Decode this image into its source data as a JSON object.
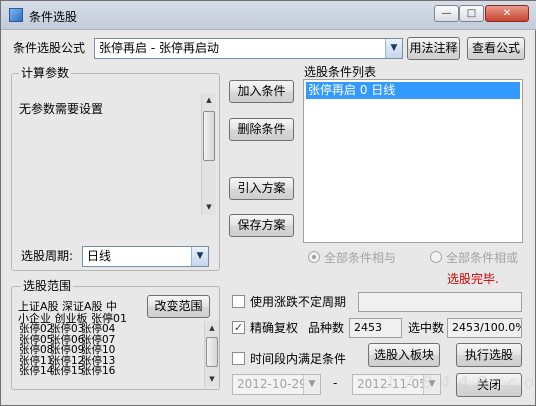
{
  "window": {
    "title": "条件选股",
    "minimize": "—",
    "maximize": "□",
    "close": "✕"
  },
  "formula": {
    "label": "条件选股公式",
    "selected": "张停再启 - 张停再启动",
    "usage_button": "用法注释",
    "view_button": "查看公式"
  },
  "params": {
    "group_label": "计算参数",
    "message": "无参数需要设置",
    "period_label": "选股周期:",
    "period_value": "日线"
  },
  "actions": {
    "add": "加入条件",
    "delete": "删除条件",
    "import": "引入方案",
    "save": "保存方案"
  },
  "conditions": {
    "list_label": "选股条件列表",
    "items": [
      "张停再启  0  日线"
    ],
    "radio_and": "全部条件相与",
    "radio_or": "全部条件相或",
    "status": "选股完毕.",
    "status_color": "#cc0000"
  },
  "scope": {
    "group_label": "选股范围",
    "change_button": "改变范围",
    "lines": [
      "上证A股  深证A股  中",
      "小企业  创业板  张停01"
    ],
    "items": [
      "张停02",
      "张停03",
      "张停04",
      "张停05",
      "张停06",
      "张停07",
      "张停08",
      "张停09",
      "张停10",
      "张停11",
      "张停12",
      "张停13",
      "张停14",
      "张停15",
      "张停16"
    ]
  },
  "options": {
    "uncertain_period": "使用涨跌不定周期",
    "uncertain_checked": false,
    "adjusted": "精确复权",
    "adjusted_checked": true,
    "variety_label": "品种数",
    "variety_value": "2453",
    "selected_label": "选中数",
    "selected_value": "2453/100.0%",
    "time_range": "时间段内满足条件",
    "time_range_checked": false,
    "date_from": "2012-10-29",
    "date_sep": "-",
    "date_to": "2012-11-05",
    "to_block_button": "选股入板块",
    "run_button": "执行选股",
    "close_button": "关闭"
  },
  "watermark": "1 7 8 4 4 8 . c o m"
}
